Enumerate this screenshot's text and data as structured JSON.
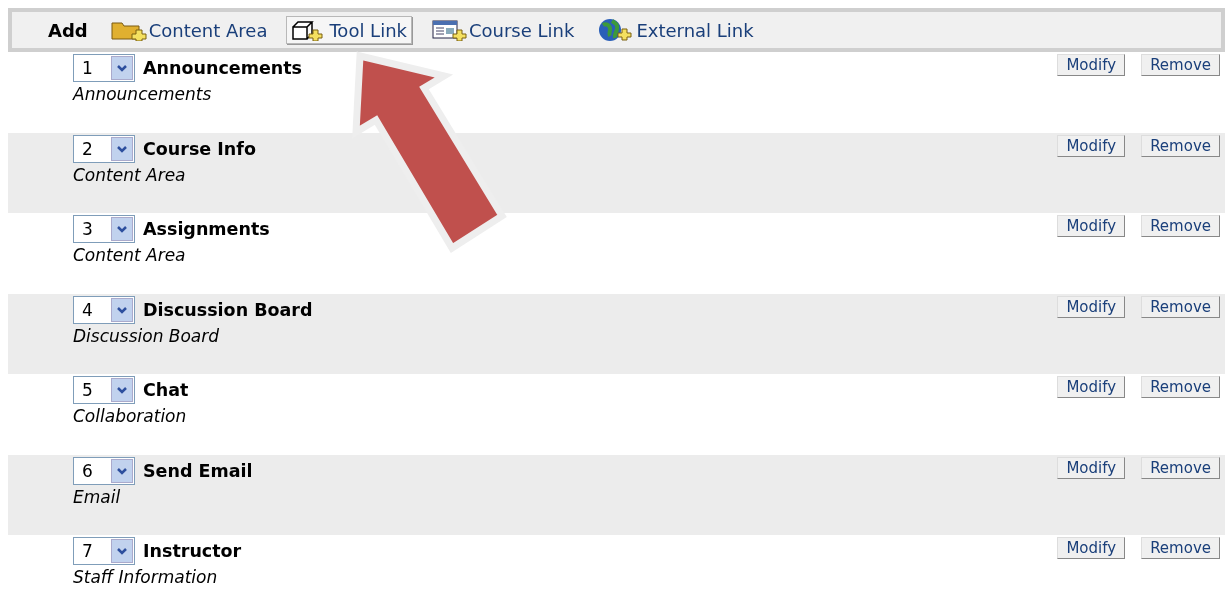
{
  "toolbar": {
    "label": "Add",
    "items": [
      {
        "kind": "folder",
        "label": "Content Area",
        "highlighted": false
      },
      {
        "kind": "tool",
        "label": "Tool Link",
        "highlighted": true
      },
      {
        "kind": "course",
        "label": "Course Link",
        "highlighted": false
      },
      {
        "kind": "globe",
        "label": "External Link",
        "highlighted": false
      }
    ]
  },
  "menu_items": [
    {
      "order": "1",
      "title": "Announcements",
      "type": "Announcements",
      "modify": "Modify",
      "remove": "Remove"
    },
    {
      "order": "2",
      "title": "Course Info",
      "type": "Content Area",
      "modify": "Modify",
      "remove": "Remove"
    },
    {
      "order": "3",
      "title": "Assignments",
      "type": "Content Area",
      "modify": "Modify",
      "remove": "Remove"
    },
    {
      "order": "4",
      "title": "Discussion Board",
      "type": "Discussion Board",
      "modify": "Modify",
      "remove": "Remove"
    },
    {
      "order": "5",
      "title": "Chat",
      "type": "Collaboration",
      "modify": "Modify",
      "remove": "Remove"
    },
    {
      "order": "6",
      "title": "Send Email",
      "type": "Email",
      "modify": "Modify",
      "remove": "Remove"
    },
    {
      "order": "7",
      "title": "Instructor",
      "type": "Staff Information",
      "modify": "Modify",
      "remove": "Remove"
    }
  ]
}
